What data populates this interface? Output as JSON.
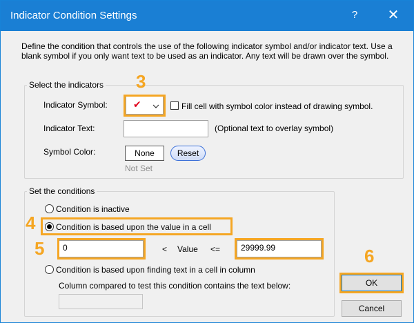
{
  "window": {
    "title": "Indicator Condition Settings",
    "help_glyph": "?",
    "close_glyph": "✕"
  },
  "description": "Define the condition that controls the use of the following indicator symbol and/or indicator text. Use a blank symbol if you only want text to be used as an indicator. Any text will be drawn over the symbol.",
  "indicators_group": {
    "legend": "Select the indicators",
    "symbol_label": "Indicator Symbol:",
    "symbol_glyph": "✔",
    "symbol_color": "#e0001b",
    "fill_checkbox_label": "Fill cell with symbol color instead of drawing symbol.",
    "fill_checked": false,
    "text_label": "Indicator Text:",
    "text_value": "",
    "text_hint": "(Optional text to overlay symbol)",
    "color_label": "Symbol Color:",
    "color_value": "None",
    "reset_label": "Reset",
    "not_set_text": "Not Set"
  },
  "conditions_group": {
    "legend": "Set the conditions",
    "radio_inactive": "Condition is inactive",
    "radio_value": "Condition is based upon the value in a cell",
    "selected": "value",
    "lower_value": "0",
    "lt_text": "<",
    "value_text": "Value",
    "lte_text": "<=",
    "upper_value": "29999.99",
    "radio_text": "Condition is based upon finding text in a cell in column",
    "column_text_label": "Column compared to test this condition contains the text below:",
    "column_text_value": ""
  },
  "buttons": {
    "ok": "OK",
    "cancel": "Cancel"
  },
  "annotations": {
    "step3": "3",
    "step4": "4",
    "step5": "5",
    "step6": "6",
    "color": "#f5a623"
  }
}
